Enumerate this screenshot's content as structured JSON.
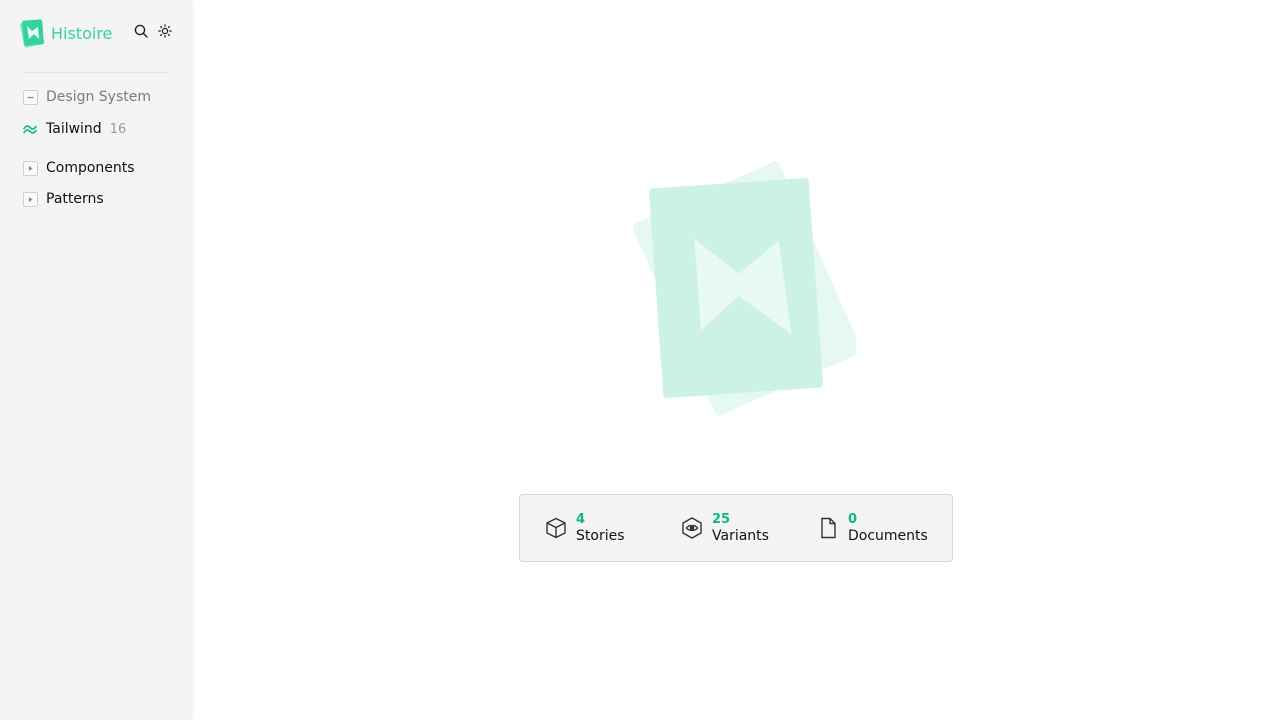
{
  "app": {
    "name": "Histoire",
    "brand_color": "#34d399"
  },
  "header": {
    "search_icon": "search-icon",
    "theme_icon": "sun-icon"
  },
  "sidebar": {
    "items": [
      {
        "label": "Design System",
        "icon": "minus-box-icon",
        "count": ""
      },
      {
        "label": "Tailwind",
        "icon": "tailwind-icon",
        "count": "16"
      },
      {
        "label": "Components",
        "icon": "caret-right-box-icon",
        "count": ""
      },
      {
        "label": "Patterns",
        "icon": "caret-right-box-icon",
        "count": ""
      }
    ]
  },
  "stats": {
    "stories": {
      "value": "4",
      "label": "Stories",
      "icon": "cube-icon"
    },
    "variants": {
      "value": "25",
      "label": "Variants",
      "icon": "eye-hexagon-icon"
    },
    "documents": {
      "value": "0",
      "label": "Documents",
      "icon": "document-icon"
    }
  },
  "colors": {
    "accent": "#10b981",
    "hero_light": "#ccf2e3",
    "hero_lighter": "#e5f9f1"
  }
}
